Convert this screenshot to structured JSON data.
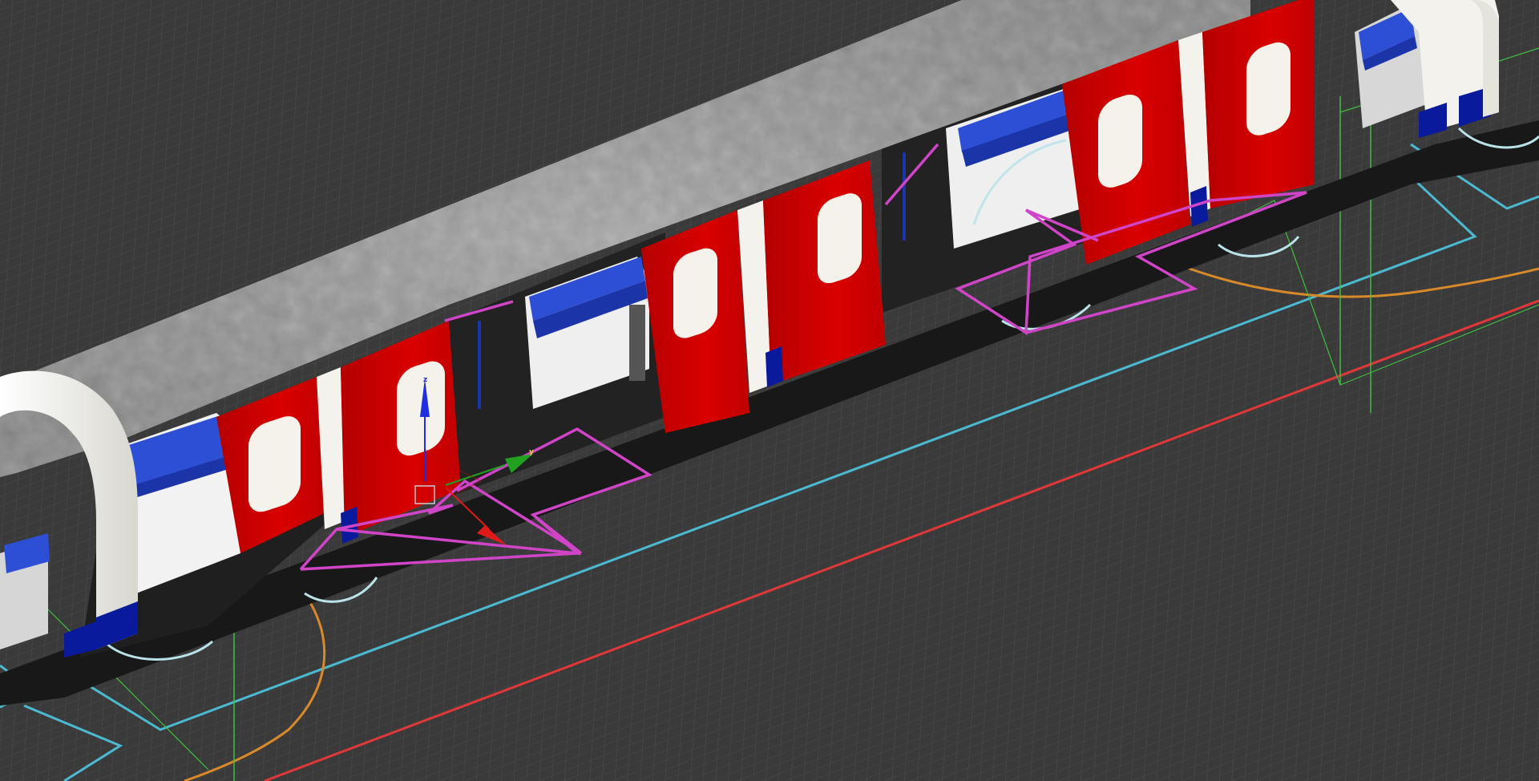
{
  "viewport": {
    "background_color": "#3b3b3b",
    "grid_color": "#5a5a5a"
  },
  "train": {
    "door_color": "#d40000",
    "roof_color": "#9a9a9a",
    "body_white": "#f0efe8",
    "seat_color": "#2d4fd6",
    "floor_color": "#1e1e1e"
  },
  "guides": {
    "red_line_color": "#e03838",
    "cyan_line_color": "#4bbad0",
    "magenta_line_color": "#d044c8",
    "orange_line_color": "#d88a2a",
    "green_line_color": "#3fbf3f"
  },
  "gizmo": {
    "z_label": "z",
    "y_label": "y",
    "z_color": "#1f2fe0",
    "y_color": "#22a022",
    "x_color": "#e01a1a"
  }
}
